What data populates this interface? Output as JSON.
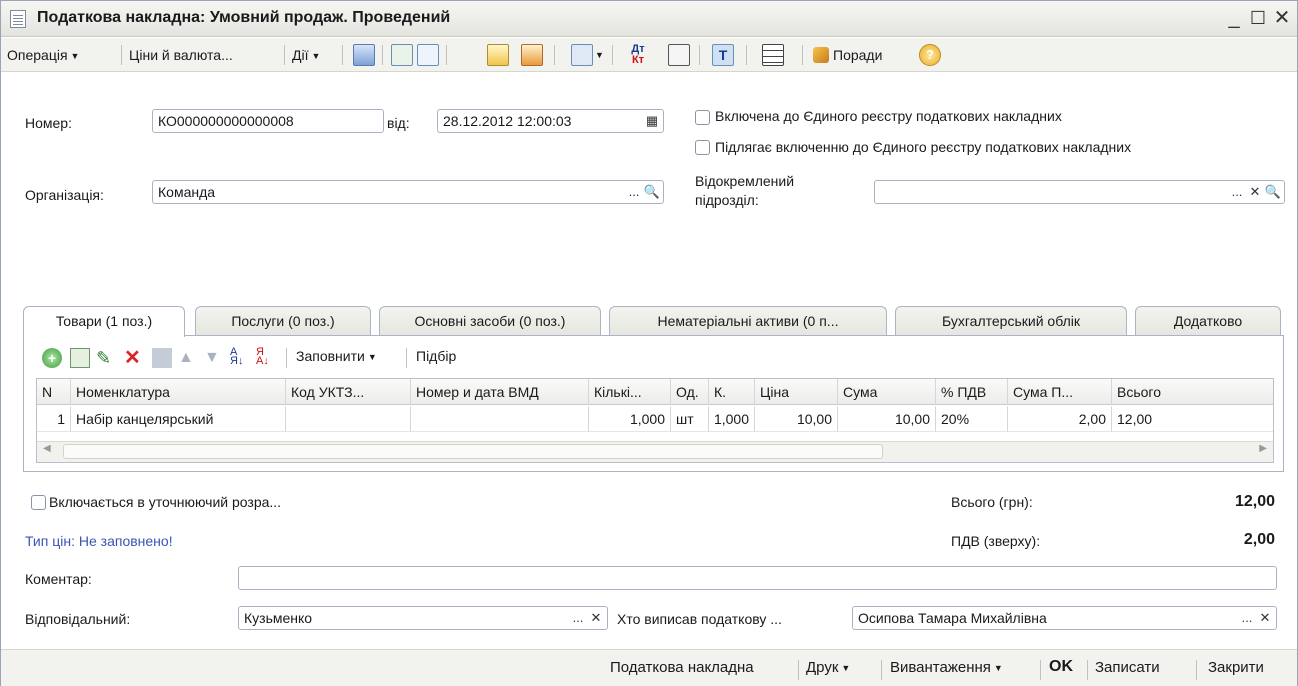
{
  "window": {
    "title": "Податкова накладна: Умовний продаж. Проведений"
  },
  "toolbar": {
    "operation_label": "Операція",
    "prices_label": "Ціни й валюта...",
    "actions_label": "Дії",
    "tips_label": "Поради"
  },
  "header": {
    "number_label": "Номер:",
    "number_value": "КО000000000000008",
    "date_label": "від:",
    "date_value": "28.12.2012 12:00:03",
    "org_label": "Організація:",
    "org_value": "Команда",
    "included_registry_label": "Включена до Єдиного реєстру податкових накладних",
    "subject_registry_label": "Підлягає включенню до Єдиного реєстру податкових накладних",
    "division_label_line1": "Відокремлений",
    "division_label_line2": "підрозділ:",
    "division_value": ""
  },
  "tabs": [
    {
      "label": "Товари (1 поз.)"
    },
    {
      "label": "Послуги (0 поз.)"
    },
    {
      "label": "Основні засоби (0 поз.)"
    },
    {
      "label": "Нематеріальні активи (0 п..."
    },
    {
      "label": "Бухгалтерський облік"
    },
    {
      "label": "Додатково"
    }
  ],
  "goods_toolbar": {
    "fill_label": "Заповнити",
    "pick_label": "Підбір"
  },
  "table": {
    "columns": [
      "N",
      "Номенклатура",
      "Код УКТЗ...",
      "Номер и дата ВМД",
      "Кількі...",
      "Од.",
      "К.",
      "Ціна",
      "Сума",
      "% ПДВ",
      "Сума П...",
      "Всього"
    ],
    "rows": [
      [
        "1",
        "Набір канцелярський",
        "",
        "",
        "1,000",
        "шт",
        "1,000",
        "10,00",
        "10,00",
        "20%",
        "2,00",
        "12,00"
      ]
    ]
  },
  "footer": {
    "includes_calc_label": "Включається в уточнюючий розра...",
    "total_label": "Всього (грн):",
    "total_value": "12,00",
    "price_type_text": "Тип цін: Не заповнено!",
    "vat_label": "ПДВ (зверху):",
    "vat_value": "2,00",
    "comment_label": "Коментар:",
    "comment_value": "",
    "responsible_label": "Відповідальний:",
    "responsible_value": "Кузьменко",
    "issuer_label": "Хто виписав податкову ...",
    "issuer_value": "Осипова Тамара Михайлівна"
  },
  "bottom_bar": {
    "tax_invoice_label": "Податкова накладна",
    "print_label": "Друк",
    "export_label": "Вивантаження",
    "ok_label": "OK",
    "save_label": "Записати",
    "close_label": "Закрити"
  },
  "colors": {
    "link_blue": "#3a55b4",
    "border": "#a9b3c4"
  }
}
